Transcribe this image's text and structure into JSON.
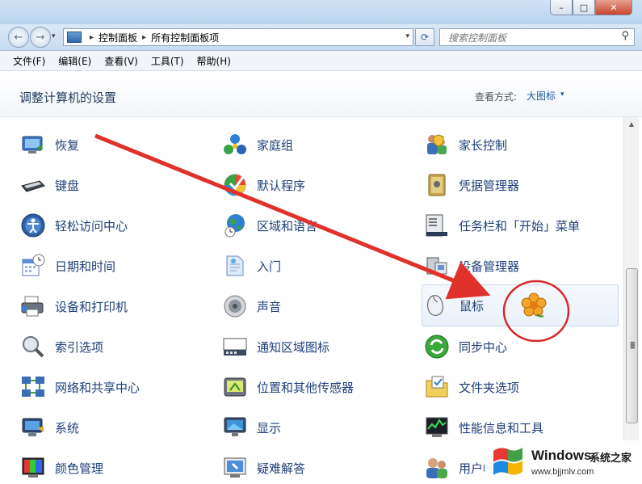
{
  "nav": {
    "back_glyph": "←",
    "forward_glyph": "→",
    "dropdown_glyph": "▾",
    "breadcrumb": [
      "控制面板",
      "所有控制面板项"
    ],
    "breadcrumb_sep": "▸",
    "search_placeholder": "搜索控制面板"
  },
  "window_buttons": {
    "min": "–",
    "max": "□",
    "close": "✕"
  },
  "menu": [
    "文件(F)",
    "编辑(E)",
    "查看(V)",
    "工具(T)",
    "帮助(H)"
  ],
  "header": {
    "title": "调整计算机的设置",
    "view_label": "查看方式:",
    "view_value": "大图标",
    "view_arrow": "▾"
  },
  "items": [
    {
      "label": "恢复",
      "icon": "recovery-icon"
    },
    {
      "label": "家庭组",
      "icon": "homegroup-icon"
    },
    {
      "label": "家长控制",
      "icon": "parental-controls-icon"
    },
    {
      "label": "键盘",
      "icon": "keyboard-icon"
    },
    {
      "label": "默认程序",
      "icon": "default-programs-icon"
    },
    {
      "label": "凭据管理器",
      "icon": "credential-manager-icon"
    },
    {
      "label": "轻松访问中心",
      "icon": "ease-of-access-icon"
    },
    {
      "label": "区域和语言",
      "icon": "region-language-icon"
    },
    {
      "label": "任务栏和「开始」菜单",
      "icon": "taskbar-icon"
    },
    {
      "label": "日期和时间",
      "icon": "date-time-icon"
    },
    {
      "label": "入门",
      "icon": "getting-started-icon"
    },
    {
      "label": "设备管理器",
      "icon": "device-manager-icon"
    },
    {
      "label": "设备和打印机",
      "icon": "devices-printers-icon"
    },
    {
      "label": "声音",
      "icon": "sound-icon"
    },
    {
      "label": "鼠标",
      "icon": "mouse-icon"
    },
    {
      "label": "索引选项",
      "icon": "indexing-icon"
    },
    {
      "label": "通知区域图标",
      "icon": "notification-area-icon"
    },
    {
      "label": "同步中心",
      "icon": "sync-center-icon"
    },
    {
      "label": "网络和共享中心",
      "icon": "network-icon"
    },
    {
      "label": "位置和其他传感器",
      "icon": "location-sensors-icon"
    },
    {
      "label": "文件夹选项",
      "icon": "folder-options-icon"
    },
    {
      "label": "系统",
      "icon": "system-icon"
    },
    {
      "label": "显示",
      "icon": "display-icon"
    },
    {
      "label": "性能信息和工具",
      "icon": "performance-icon"
    },
    {
      "label": "颜色管理",
      "icon": "color-management-icon"
    },
    {
      "label": "疑难解答",
      "icon": "troubleshooting-icon"
    },
    {
      "label": "用户帐户",
      "icon": "user-accounts-icon"
    }
  ],
  "watermark": {
    "brand": "Windows",
    "sub": "系统之家",
    "url": "www.bjjmlv.com"
  },
  "colors": {
    "link": "#1d3f7a",
    "arrow": "#e0312b"
  }
}
